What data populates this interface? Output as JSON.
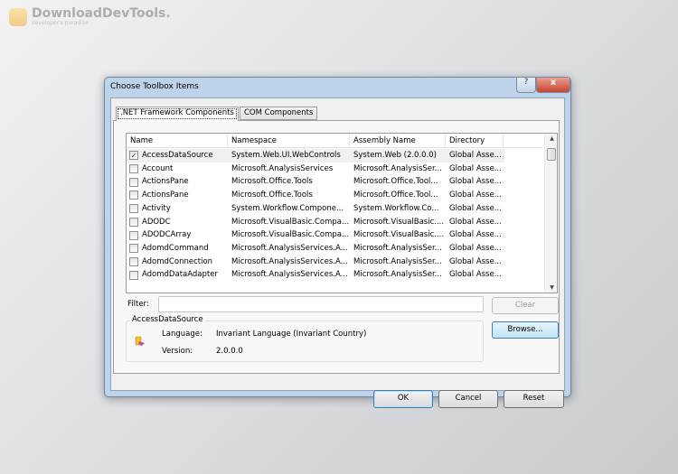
{
  "watermark": {
    "brand": "DownloadDevTools.",
    "tagline": "developer's paradise"
  },
  "dialog": {
    "title": "Choose Toolbox Items",
    "help": "?",
    "close": "x"
  },
  "tabs": [
    {
      "label": ".NET Framework Components",
      "active": true
    },
    {
      "label": "COM Components",
      "active": false
    }
  ],
  "columns": [
    "Name",
    "Namespace",
    "Assembly Name",
    "Directory"
  ],
  "rows": [
    {
      "checked": true,
      "name": "AccessDataSource",
      "ns": "System.Web.UI.WebControls",
      "asm": "System.Web (2.0.0.0)",
      "dir": "Global Asse..."
    },
    {
      "checked": false,
      "name": "Account",
      "ns": "Microsoft.AnalysisServices",
      "asm": "Microsoft.AnalysisSer...",
      "dir": "Global Asse..."
    },
    {
      "checked": false,
      "name": "ActionsPane",
      "ns": "Microsoft.Office.Tools",
      "asm": "Microsoft.Office.Tool...",
      "dir": "Global Asse..."
    },
    {
      "checked": false,
      "name": "ActionsPane",
      "ns": "Microsoft.Office.Tools",
      "asm": "Microsoft.Office.Tool...",
      "dir": "Global Asse..."
    },
    {
      "checked": false,
      "name": "Activity",
      "ns": "System.Workflow.Compone...",
      "asm": "System.Workflow.Co...",
      "dir": "Global Asse..."
    },
    {
      "checked": false,
      "name": "ADODC",
      "ns": "Microsoft.VisualBasic.Compa...",
      "asm": "Microsoft.VisualBasic....",
      "dir": "Global Asse..."
    },
    {
      "checked": false,
      "name": "ADODCArray",
      "ns": "Microsoft.VisualBasic.Compa...",
      "asm": "Microsoft.VisualBasic....",
      "dir": "Global Asse..."
    },
    {
      "checked": false,
      "name": "AdomdCommand",
      "ns": "Microsoft.AnalysisServices.A...",
      "asm": "Microsoft.AnalysisSer...",
      "dir": "Global Asse..."
    },
    {
      "checked": false,
      "name": "AdomdConnection",
      "ns": "Microsoft.AnalysisServices.A...",
      "asm": "Microsoft.AnalysisSer...",
      "dir": "Global Asse..."
    },
    {
      "checked": false,
      "name": "AdomdDataAdapter",
      "ns": "Microsoft.AnalysisServices.A...",
      "asm": "Microsoft.AnalysisSer...",
      "dir": "Global Asse..."
    }
  ],
  "filter": {
    "label": "Filter:",
    "value": ""
  },
  "buttons": {
    "clear": "Clear",
    "browse": "Browse...",
    "ok": "OK",
    "cancel": "Cancel",
    "reset": "Reset"
  },
  "details": {
    "title": "AccessDataSource",
    "language_label": "Language:",
    "language": "Invariant Language (Invariant Country)",
    "version_label": "Version:",
    "version": "2.0.0.0"
  }
}
